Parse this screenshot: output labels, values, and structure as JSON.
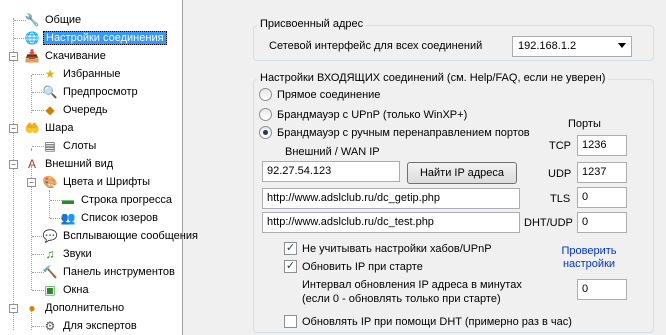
{
  "tree": {
    "items": [
      {
        "label": "Общие",
        "icon": "wrench-icon"
      },
      {
        "label": "Настройки соединения",
        "icon": "network-icon"
      },
      {
        "label": "Скачивание",
        "icon": "download-icon"
      },
      {
        "label": "Избранные",
        "icon": "star-icon"
      },
      {
        "label": "Предпросмотр",
        "icon": "preview-icon"
      },
      {
        "label": "Очередь",
        "icon": "queue-icon"
      },
      {
        "label": "Шара",
        "icon": "share-icon"
      },
      {
        "label": "Слоты",
        "icon": "slots-icon"
      },
      {
        "label": "Внешний вид",
        "icon": "appearance-icon"
      },
      {
        "label": "Цвета и Шрифты",
        "icon": "palette-icon"
      },
      {
        "label": "Строка прогресса",
        "icon": "progress-icon"
      },
      {
        "label": "Список юзеров",
        "icon": "users-icon"
      },
      {
        "label": "Всплывающие сообщения",
        "icon": "popup-icon"
      },
      {
        "label": "Звуки",
        "icon": "sound-icon"
      },
      {
        "label": "Панель инструментов",
        "icon": "toolbar-icon"
      },
      {
        "label": "Окна",
        "icon": "windows-icon"
      },
      {
        "label": "Дополнительно",
        "icon": "advanced-icon"
      },
      {
        "label": "Для экспертов",
        "icon": "experts-icon"
      }
    ]
  },
  "assigned": {
    "title": "Присвоенный адрес",
    "iface_label": "Сетевой интерфейс для всех соединений",
    "iface_value": "192.168.1.2"
  },
  "incoming": {
    "title": "Настройки ВХОДЯЩИХ соединений (см. Help/FAQ, если не уверен)",
    "radio_direct": "Прямое соединение",
    "radio_upnp": "Брандмауэр с UPnP (только WinXP+)",
    "radio_manual": "Брандмауэр с ручным перенаправлением портов",
    "wan_label": "Внешний / WAN IP",
    "wan_value": "92.27.54.123",
    "find_ip_button": "Найти IP адреса",
    "getip_url": "http://www.adslclub.ru/dc_getip.php",
    "test_url": "http://www.adslclub.ru/dc_test.php",
    "ports_label": "Порты",
    "tcp_label": "TCP",
    "tcp_value": "1236",
    "udp_label": "UDP",
    "udp_value": "1237",
    "tls_label": "TLS",
    "tls_value": "0",
    "dht_label": "DHT/UDP",
    "dht_value": "0",
    "chk_ignore_hub": "Не учитывать настройки хабов/UPnP",
    "chk_update_ip": "Обновить IP при старте",
    "check_settings_link": "Проверить настройки",
    "interval_label_line1": "Интервал обновления IP адреса в минутах",
    "interval_label_line2": "(если 0 - обновлять только при старте)",
    "interval_value": "0",
    "chk_dht": "Обновлять IP при помощи DHT (примерно раз в час)"
  },
  "colors": {
    "selection": "#3399ff",
    "link": "#0033cc",
    "groupbox_border": "#d5dfe5"
  }
}
